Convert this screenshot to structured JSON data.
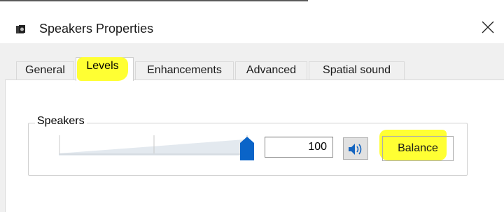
{
  "window": {
    "title": "Speakers Properties",
    "app_icon": "speaker-device-icon",
    "close_icon": "close-icon"
  },
  "tabs": [
    {
      "label": "General"
    },
    {
      "label": "Levels",
      "active": true,
      "highlighted": true
    },
    {
      "label": "Enhancements"
    },
    {
      "label": "Advanced"
    },
    {
      "label": "Spatial sound"
    }
  ],
  "levels": {
    "group_label": "Speakers",
    "volume_value": "100",
    "volume_fraction": 1.0,
    "mute_icon": "speaker-volume-icon",
    "balance_label": "Balance",
    "balance_highlighted": true
  },
  "colors": {
    "highlight": "#ffff33",
    "slider_thumb": "#0a64c8",
    "panel": "#ffffff",
    "chrome": "#f0f0f0"
  }
}
